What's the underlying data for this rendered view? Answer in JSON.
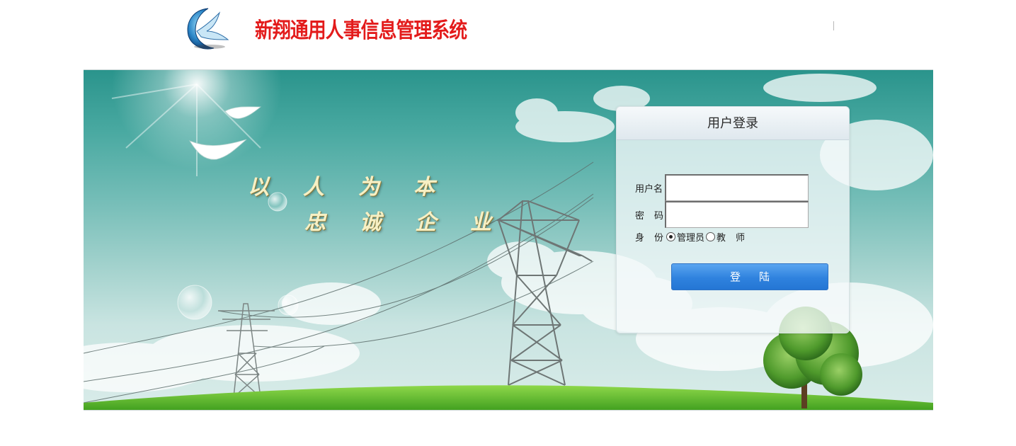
{
  "header": {
    "logo_icon": "dove-crescent-logo",
    "system_title": "新翔通用人事信息管理系统"
  },
  "banner": {
    "slogan_line1": "以人为本",
    "slogan_line2": "忠诚企业"
  },
  "login": {
    "title": "用户登录",
    "username_label": "用户名",
    "username_value": "",
    "password_label": "密码",
    "password_value": "",
    "role_label": "身份",
    "role_options": [
      {
        "label": "管理员",
        "selected": true
      },
      {
        "label": "教师",
        "selected": false
      }
    ],
    "submit_label": "登陆"
  },
  "colors": {
    "title_red": "#e31b1b",
    "button_blue": "#2f82de",
    "sky_teal": "#2a948c"
  }
}
